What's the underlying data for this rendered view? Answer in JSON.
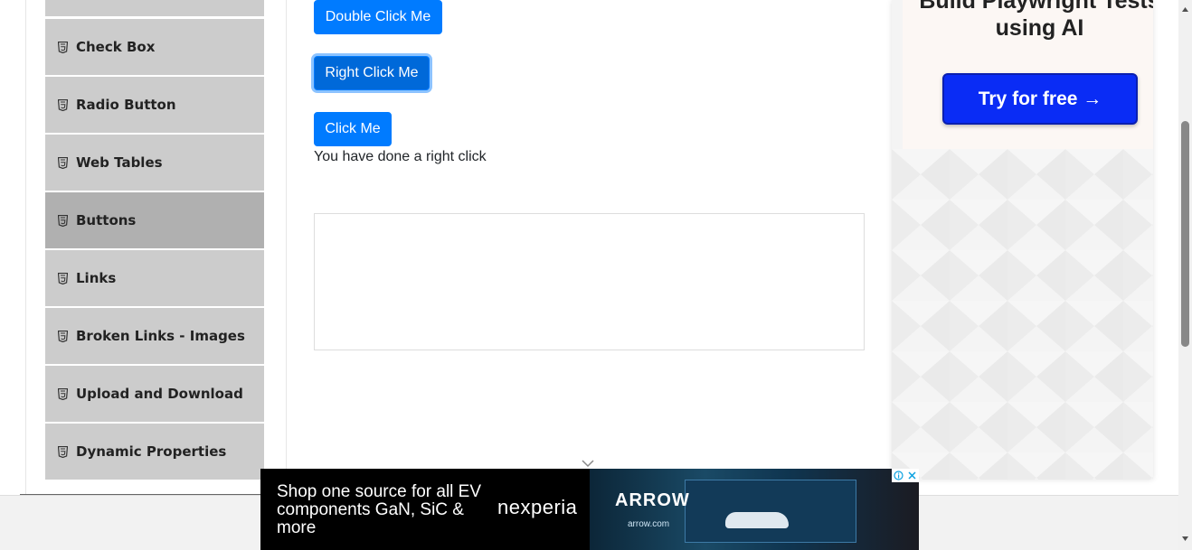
{
  "sidebar": {
    "items": [
      {
        "label": "",
        "active": false
      },
      {
        "label": "Check Box",
        "active": false
      },
      {
        "label": "Radio Button",
        "active": false
      },
      {
        "label": "Web Tables",
        "active": false
      },
      {
        "label": "Buttons",
        "active": true
      },
      {
        "label": "Links",
        "active": false
      },
      {
        "label": "Broken Links - Images",
        "active": false
      },
      {
        "label": "Upload and Download",
        "active": false
      },
      {
        "label": "Dynamic Properties",
        "active": false
      }
    ]
  },
  "main": {
    "double_click_label": "Double Click Me",
    "right_click_label": "Right Click Me",
    "click_label": "Click Me",
    "message": "You have done a right click"
  },
  "right_ad": {
    "title": "Build Playwright Tests using AI",
    "cta": "Try for free →"
  },
  "bottom_ad": {
    "text": "Shop one source for all EV components GaN, SiC & more",
    "brand": "nexperia",
    "partner_logo": "ARROW",
    "partner_url": "arrow.com"
  },
  "colors": {
    "primary": "#007bff",
    "sidebar_item": "#cccccc",
    "sidebar_active": "#b0b0b0",
    "ad_cta": "#0a2cf5"
  }
}
